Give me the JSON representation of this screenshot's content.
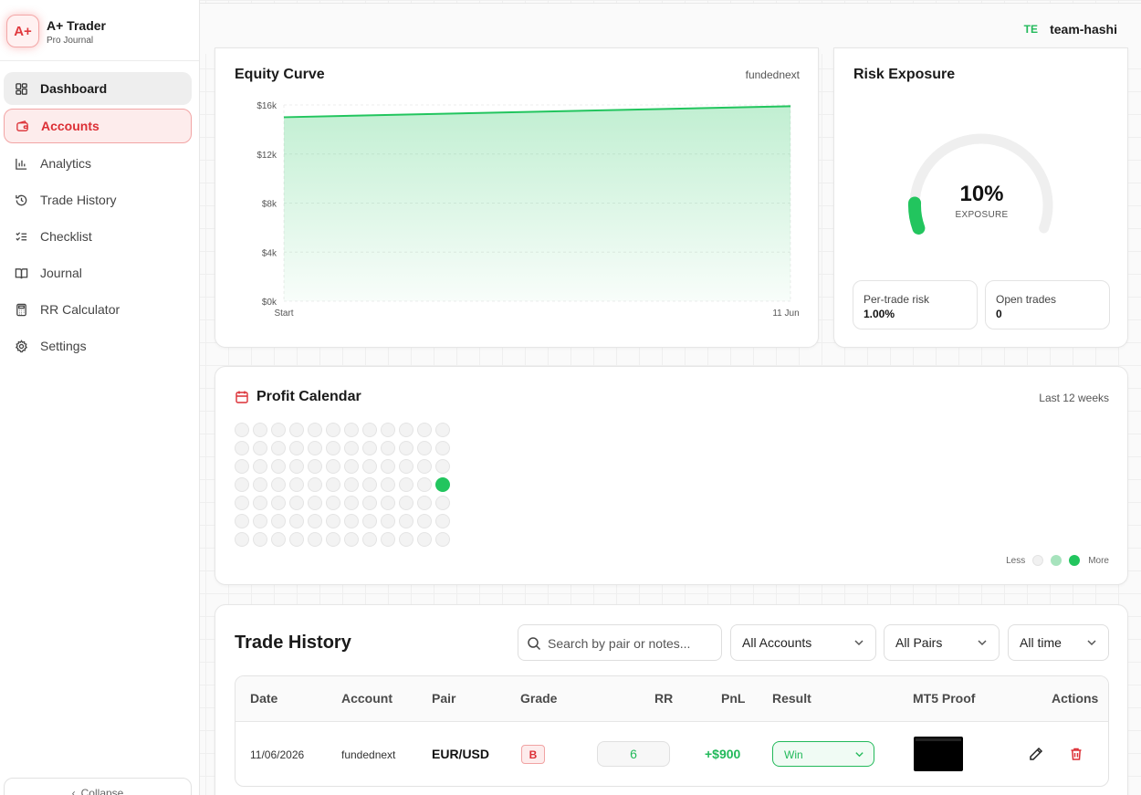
{
  "brand": {
    "logo": "A+",
    "name": "A+ Trader",
    "subtitle": "Pro Journal"
  },
  "nav": [
    {
      "label": "Dashboard",
      "icon": "dashboard-icon",
      "state": "hover"
    },
    {
      "label": "Accounts",
      "icon": "wallet-icon",
      "state": "active"
    },
    {
      "label": "Analytics",
      "icon": "bar-chart-icon",
      "state": "default"
    },
    {
      "label": "Trade History",
      "icon": "history-icon",
      "state": "default"
    },
    {
      "label": "Checklist",
      "icon": "checklist-icon",
      "state": "default"
    },
    {
      "label": "Journal",
      "icon": "book-icon",
      "state": "default"
    },
    {
      "label": "RR Calculator",
      "icon": "calculator-icon",
      "state": "default"
    },
    {
      "label": "Settings",
      "icon": "gear-icon",
      "state": "default"
    }
  ],
  "sidebar_footer": {
    "collapse_label": "Collapse"
  },
  "topbar": {
    "team_initials": "TE",
    "team_name": "team-hashi"
  },
  "equity": {
    "title": "Equity Curve",
    "account": "fundednext"
  },
  "chart_data": {
    "type": "area",
    "title": "Equity Curve",
    "x": [
      "Start",
      "11 Jun"
    ],
    "series": [
      {
        "values": [
          15000,
          15900
        ]
      }
    ],
    "yticks": [
      "$0k",
      "$4k",
      "$8k",
      "$12k",
      "$16k"
    ],
    "ylim": [
      0,
      16000
    ],
    "color": "#22c55e",
    "grid": true
  },
  "risk": {
    "title": "Risk Exposure",
    "value": "10%",
    "value_fraction": 0.1,
    "label": "EXPOSURE",
    "per_trade_label": "Per-trade risk",
    "per_trade_value": "1.00%",
    "open_trades_label": "Open trades",
    "open_trades_value": "0"
  },
  "calendar": {
    "title": "Profit Calendar",
    "range_label": "Last 12 weeks",
    "rows": 7,
    "cols": 12,
    "active_cells": [
      {
        "row": 3,
        "col": 11,
        "level": "high"
      }
    ],
    "legend_less": "Less",
    "legend_more": "More"
  },
  "trades": {
    "title": "Trade History",
    "search_placeholder": "Search by pair or notes...",
    "filters": {
      "account": "All Accounts",
      "pair": "All Pairs",
      "time": "All time"
    },
    "columns": [
      "Date",
      "Account",
      "Pair",
      "Grade",
      "RR",
      "PnL",
      "Result",
      "MT5 Proof",
      "Actions"
    ],
    "rows": [
      {
        "date": "11/06/2026",
        "account": "fundednext",
        "pair": "EUR/USD",
        "grade": "B",
        "rr": "6",
        "pnl": "+$900",
        "result": "Win"
      }
    ]
  }
}
